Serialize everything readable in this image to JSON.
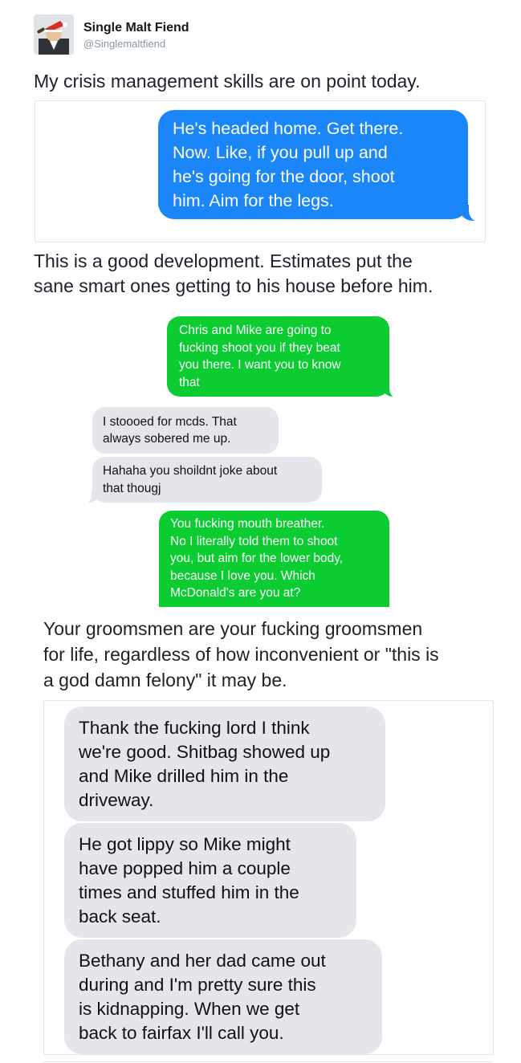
{
  "tweet": {
    "display_name": "Single Malt Fiend",
    "handle": "@Singlemaltfiend",
    "avatar_icon": "avatar-drinking-icon",
    "captions": [
      "My crisis management skills are on point today.",
      "This is a good development. Estimates put the",
      "sane smart ones getting to his house before him.",
      "Your groomsmen are your fucking groomsmen",
      "for life, regardless of how inconvenient or \"this is",
      "a god damn felony\" it may be."
    ]
  },
  "screenshot1": {
    "messages": [
      {
        "side": "sent",
        "lines": [
          "He's headed home. Get there.",
          "Now. Like, if you pull up and",
          "he's going for the door, shoot",
          "him. Aim for the legs."
        ]
      }
    ]
  },
  "screenshot2": {
    "messages": [
      {
        "side": "sent",
        "lines": [
          "Chris and Mike are going to",
          "fucking shoot you if they beat",
          "you there. I want you to know",
          "that"
        ]
      },
      {
        "side": "received",
        "lines": [
          "I stoooed for mcds. That",
          "always sobered me up."
        ]
      },
      {
        "side": "received",
        "lines": [
          "Hahaha you shoildnt joke about",
          "that thougj"
        ]
      },
      {
        "side": "sent",
        "lines": [
          "You fucking mouth breather.",
          "No I literally told them to shoot",
          "you, but aim for the lower body,",
          "because I love you. Which",
          "McDonald's are you at?"
        ]
      }
    ]
  },
  "screenshot3": {
    "messages": [
      {
        "side": "received",
        "lines": [
          "Thank the fucking lord I think",
          "we're good. Shitbag showed up",
          "and Mike drilled him in the",
          "driveway."
        ]
      },
      {
        "side": "received",
        "lines": [
          "He got lippy so Mike might",
          "have popped him a couple",
          "times and stuffed him in the",
          "back seat."
        ]
      },
      {
        "side": "received",
        "lines": [
          "Bethany and her dad came out",
          "during and I'm pretty sure this",
          "is kidnapping. When we get",
          "back to fairfax I'll call you."
        ]
      }
    ]
  },
  "colors": {
    "imessage_blue": "#1a86f8",
    "sms_green": "#0bcd32",
    "received_gray": "#e6e5eb",
    "handle_gray": "#8899a6"
  }
}
